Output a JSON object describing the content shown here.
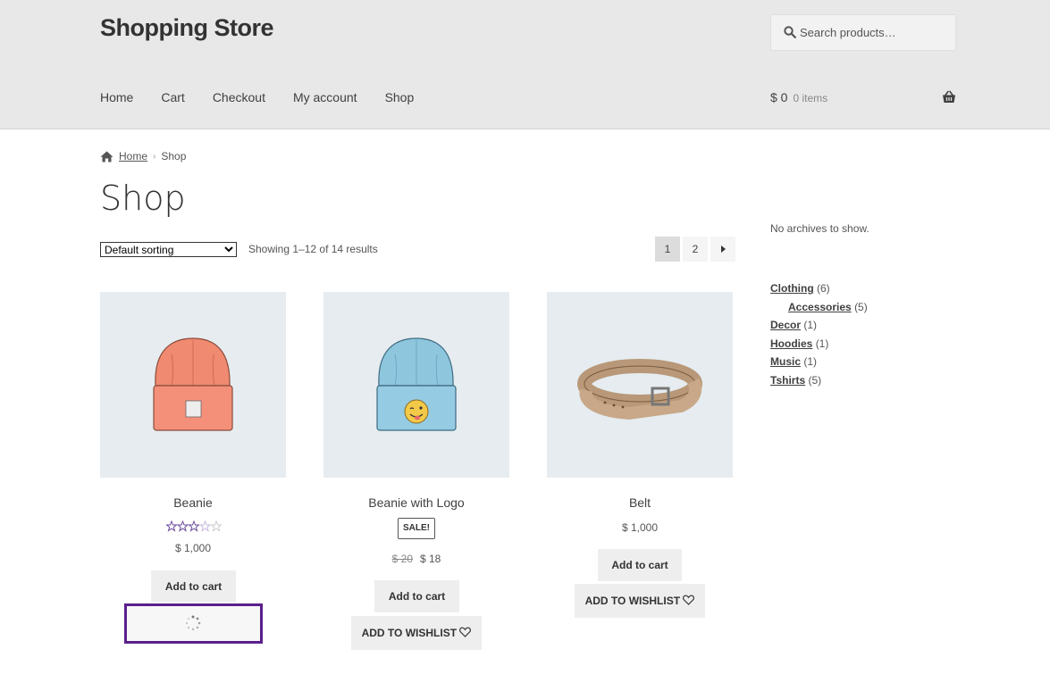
{
  "header": {
    "site_title": "Shopping Store",
    "search_placeholder": "Search products…",
    "nav": [
      "Home",
      "Cart",
      "Checkout",
      "My account",
      "Shop"
    ],
    "cart_amount": "$ 0",
    "cart_count": "0 items"
  },
  "breadcrumb": {
    "home": "Home",
    "current": "Shop"
  },
  "page": {
    "title": "Shop",
    "sort_selected": "Default sorting",
    "result_count": "Showing 1–12 of 14 results",
    "pages": [
      "1",
      "2"
    ]
  },
  "sidebar": {
    "archives_text": "No archives to show.",
    "categories": [
      {
        "name": "Clothing",
        "count": "(6)"
      },
      {
        "name": "Accessories",
        "count": "(5)"
      },
      {
        "name": "Decor",
        "count": "(1)"
      },
      {
        "name": "Hoodies",
        "count": "(1)"
      },
      {
        "name": "Music",
        "count": "(1)"
      },
      {
        "name": "Tshirts",
        "count": "(5)"
      }
    ]
  },
  "products": [
    {
      "name": "Beanie",
      "price": "$ 1,000",
      "rating": 3.5,
      "add_to_cart": "Add to cart"
    },
    {
      "name": "Beanie with Logo",
      "sale_badge": "SALE!",
      "old_price": "$ 20",
      "price": "$ 18",
      "add_to_cart": "Add to cart",
      "wishlist": "ADD TO WISHLIST"
    },
    {
      "name": "Belt",
      "price": "$ 1,000",
      "add_to_cart": "Add to cart",
      "wishlist": "ADD TO WISHLIST"
    }
  ],
  "colors": {
    "header_bg": "#e8e8e8",
    "thumb_bg": "#e6ecf0",
    "rating_purple": "#6b4b9c",
    "focus_outline": "#5b1f8c"
  }
}
